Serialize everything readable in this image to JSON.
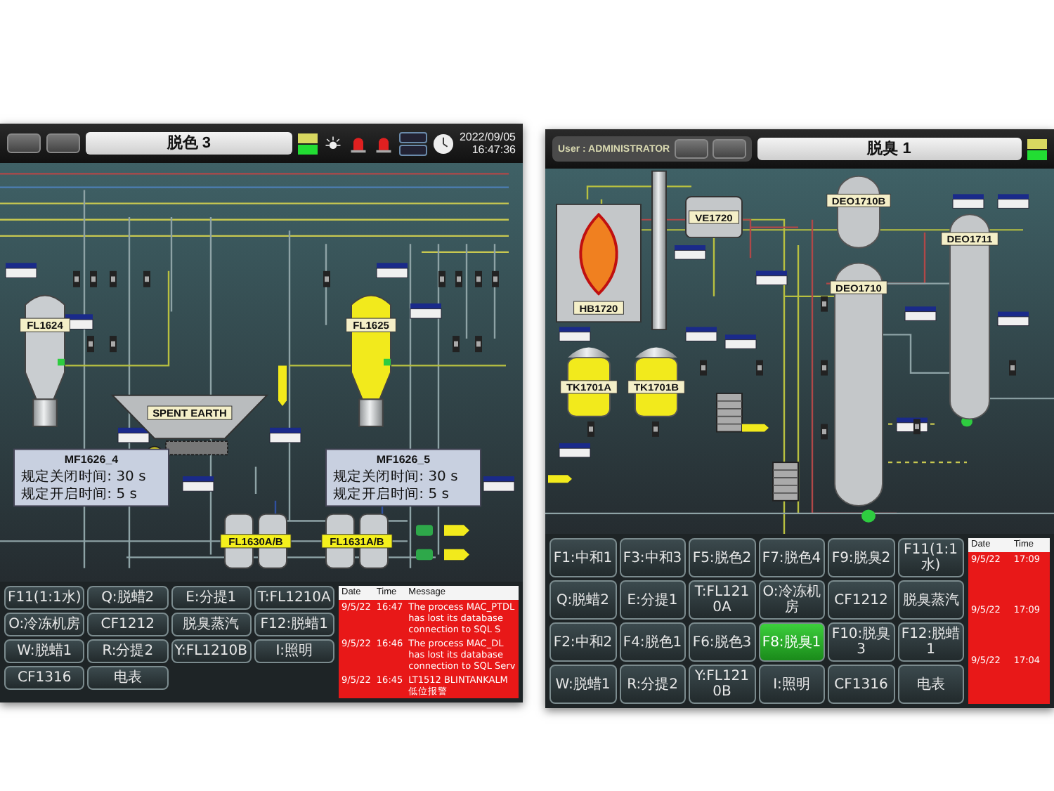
{
  "left_screen": {
    "title": "脱色 3",
    "date": "2022/09/05",
    "time": "16:47:36",
    "equipment": [
      {
        "kind": "filter",
        "label": "FL1624",
        "color": "#c9cdd0"
      },
      {
        "kind": "filter",
        "label": "FL1625",
        "color": "#f2ea1c"
      },
      {
        "kind": "hopper",
        "label": "SPENT EARTH",
        "color": "#b9bcbe"
      },
      {
        "kind": "twin",
        "label": "FL1630A/B",
        "color": "#c9cdd0"
      },
      {
        "kind": "twin",
        "label": "FL1631A/B",
        "color": "#c9cdd0"
      }
    ],
    "info_panels": [
      {
        "title": "MF1626_4",
        "lines": [
          "规定关闭时间: 30 s",
          "规定开启时间: 5 s"
        ]
      },
      {
        "title": "MF1626_5",
        "lines": [
          "规定关闭时间: 30 s",
          "规定开启时间: 5 s"
        ]
      }
    ],
    "nav_buttons": [
      {
        "label": "F11(1:1水)",
        "selected": false
      },
      {
        "label": "Q:脱蜡2",
        "selected": false
      },
      {
        "label": "E:分提1",
        "selected": false
      },
      {
        "label": "T:FL1210A",
        "selected": false
      },
      {
        "label": "O:冷冻机房",
        "selected": false
      },
      {
        "label": "CF1212",
        "selected": false
      },
      {
        "label": "脱臭蒸汽",
        "selected": false
      },
      {
        "label": "F12:脱蜡1",
        "selected": false
      },
      {
        "label": "W:脱蜡1",
        "selected": false
      },
      {
        "label": "R:分提2",
        "selected": false
      },
      {
        "label": "Y:FL1210B",
        "selected": false
      },
      {
        "label": "I:照明",
        "selected": false
      },
      {
        "label": "CF1316",
        "selected": false
      },
      {
        "label": "电表",
        "selected": false
      }
    ],
    "alarms": {
      "columns": [
        "Date",
        "Time",
        "Message"
      ],
      "rows": [
        [
          "9/5/22",
          "16:47",
          "The process MAC_PTDL has lost its database connection to SQL S"
        ],
        [
          "9/5/22",
          "16:46",
          "The process MAC_DL has lost its database connection to SQL Serv"
        ],
        [
          "9/5/22",
          "16:45",
          "LT1512 BLINTANKALM 低位报警"
        ]
      ]
    }
  },
  "right_screen": {
    "user": "User : ADMINISTRATOR",
    "title": "脱臭 1",
    "equipment": [
      {
        "kind": "furnace",
        "label": "HB1720",
        "color": "#c4c7c9"
      },
      {
        "kind": "drum",
        "label": "VE1720",
        "color": "#c4c7c9"
      },
      {
        "kind": "column",
        "label": "DEO1710B",
        "color": "#c4c7c9"
      },
      {
        "kind": "column",
        "label": "DEO1710",
        "color": "#c4c7c9"
      },
      {
        "kind": "column",
        "label": "DEO1711",
        "color": "#c4c7c9"
      },
      {
        "kind": "tank",
        "label": "TK1701A",
        "color": "#f2ea1c"
      },
      {
        "kind": "tank",
        "label": "TK1701B",
        "color": "#f2ea1c"
      }
    ],
    "nav_buttons": [
      {
        "label": "F1:中和1",
        "selected": false
      },
      {
        "label": "F3:中和3",
        "selected": false
      },
      {
        "label": "F5:脱色2",
        "selected": false
      },
      {
        "label": "F7:脱色4",
        "selected": false
      },
      {
        "label": "F9:脱臭2",
        "selected": false
      },
      {
        "label": "F11(1:1水)",
        "selected": false
      },
      {
        "label": "Q:脱蜡2",
        "selected": false
      },
      {
        "label": "E:分提1",
        "selected": false
      },
      {
        "label": "T:FL1210A",
        "selected": false
      },
      {
        "label": "O:冷冻机房",
        "selected": false
      },
      {
        "label": "CF1212",
        "selected": false
      },
      {
        "label": "脱臭蒸汽",
        "selected": false
      },
      {
        "label": "F2:中和2",
        "selected": false
      },
      {
        "label": "F4:脱色1",
        "selected": false
      },
      {
        "label": "F6:脱色3",
        "selected": false
      },
      {
        "label": "F8:脱臭1",
        "selected": true
      },
      {
        "label": "F10:脱臭3",
        "selected": false
      },
      {
        "label": "F12:脱蜡1",
        "selected": false
      },
      {
        "label": "W:脱蜡1",
        "selected": false
      },
      {
        "label": "R:分提2",
        "selected": false
      },
      {
        "label": "Y:FL1210B",
        "selected": false
      },
      {
        "label": "I:照明",
        "selected": false
      },
      {
        "label": "CF1316",
        "selected": false
      },
      {
        "label": "电表",
        "selected": false
      }
    ],
    "alarms": {
      "columns": [
        "Date",
        "Time"
      ],
      "rows": [
        [
          "9/5/22",
          "17:09"
        ],
        [
          "9/5/22",
          "17:09"
        ],
        [
          "9/5/22",
          "17:04"
        ]
      ]
    }
  }
}
